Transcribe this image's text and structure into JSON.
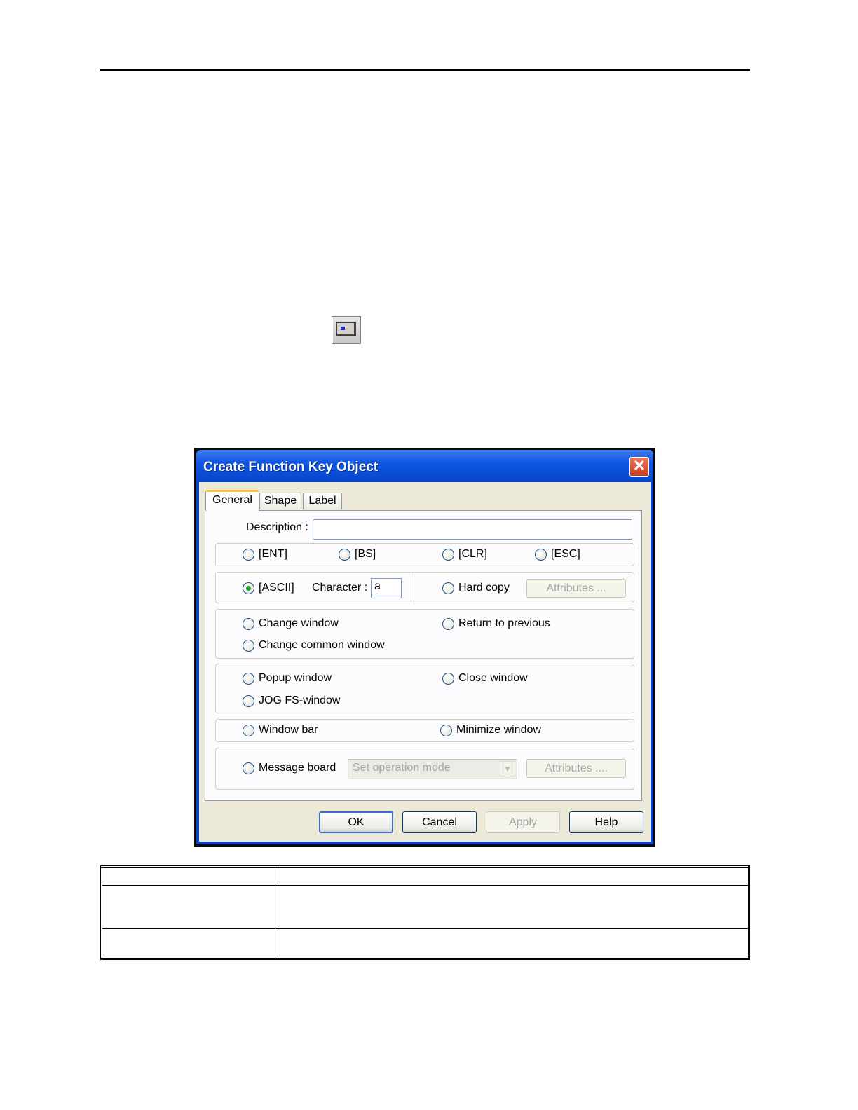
{
  "dialog": {
    "title": "Create Function Key Object",
    "close_glyph": "✕",
    "tabs": [
      {
        "label": "General"
      },
      {
        "label": "Shape"
      },
      {
        "label": "Label"
      }
    ],
    "description_label": "Description :",
    "description_value": "",
    "keys": [
      "[ENT]",
      "[BS]",
      "[CLR]",
      "[ESC]"
    ],
    "ascii": {
      "label": "[ASCII]",
      "checked": true,
      "character_label": "Character :",
      "character_value": "a"
    },
    "hard_copy": {
      "label": "Hard copy",
      "attributes_label": "Attributes ..."
    },
    "change_window": "Change window",
    "return_to_previous": "Return to previous",
    "change_common_window": "Change common window",
    "popup_window": "Popup window",
    "close_window": "Close window",
    "jog_fs_window": "JOG FS-window",
    "window_bar": "Window bar",
    "minimize_window": "Minimize window",
    "message_board": {
      "label": "Message board",
      "select_value": "Set operation mode",
      "attributes_label": "Attributes ...."
    },
    "buttons": {
      "ok": "OK",
      "cancel": "Cancel",
      "apply": "Apply",
      "help": "Help"
    }
  },
  "icons": {
    "toolbar": "function-key-icon",
    "close": "close-icon",
    "dropdown": "chevron-down-icon"
  },
  "colors": {
    "titlebar": "#0d55e0",
    "dialog_bg": "#ece9d8",
    "radio_selected": "#21a121",
    "close_button": "#c9391c"
  }
}
